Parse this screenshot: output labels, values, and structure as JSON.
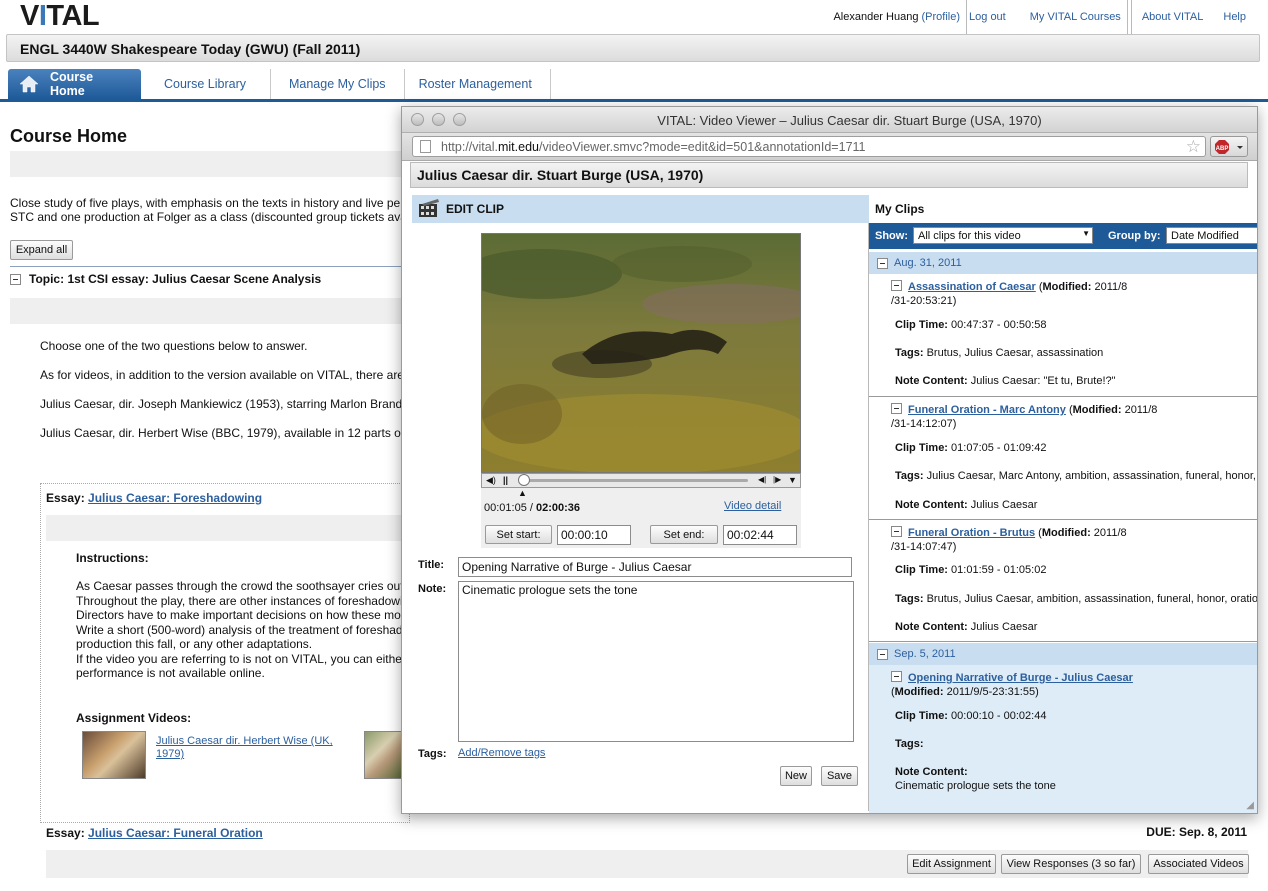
{
  "app": {
    "logo": "VITAL",
    "user": "Alexander Huang",
    "profile": "(Profile)",
    "logout": "Log out",
    "my_courses": "My VITAL Courses",
    "about": "About VITAL",
    "help": "Help",
    "course_title": "ENGL 3440W Shakespeare Today (GWU) (Fall 2011)"
  },
  "tabs": [
    "Course Home",
    "Course Library",
    "Manage My Clips",
    "Roster Management"
  ],
  "page": {
    "title": "Course Home",
    "description_line1": "Close study of five plays, with emphasis on the texts in history and live per",
    "description_line2": "STC and one production at Folger as a class (discounted group tickets ava",
    "expand_all": "Expand all",
    "topic": "Topic: 1st CSI essay: Julius Caesar Scene Analysis",
    "paras": [
      "Choose one of the two questions below to answer.",
      "As for videos, in addition to the version available on VITAL, there are",
      "Julius Caesar, dir. Joseph Mankiewicz (1953), starring Marlon Brand",
      "Julius Caesar, dir. Herbert Wise (BBC, 1979), available in 12 parts o"
    ],
    "essay1_prefix": "Essay: ",
    "essay1_link": "Julius Caesar: Foreshadowing",
    "instructions_label": "Instructions:",
    "instructions": [
      "As Caesar passes through the crowd the soothsayer cries out",
      "Throughout the play, there are other instances of foreshadowi",
      "Directors have to make important decisions on how these mo",
      "Write a short (500-word) analysis of the treatment of foreshad",
      "production this fall, or any other adaptations.",
      "If the video you are referring to is not on VITAL, you can eithe",
      "performance is not available online."
    ],
    "assignment_videos_label": "Assignment Videos:",
    "assignment_video_link_1": "Julius Caesar dir. Herbert Wise (UK,",
    "assignment_video_link_2": "1979)",
    "essay2_prefix": "Essay: ",
    "essay2_link": "Julius Caesar: Funeral Oration",
    "essay2_due": "DUE: Sep. 8, 2011",
    "buttons": [
      "Edit Assignment",
      "View Responses (3 so far)",
      "Associated Videos"
    ]
  },
  "popup": {
    "window_title": "VITAL: Video Viewer – Julius Caesar dir. Stuart Burge (USA, 1970)",
    "url_prefix": "http://vital.",
    "url_domain": "mit.edu",
    "url_rest": "/videoViewer.smvc?mode=edit&id=501&annotationId=1711",
    "video_title": "Julius Caesar dir. Stuart Burge (USA, 1970)",
    "edit_clip_label": "EDIT CLIP",
    "current_time": "00:01:05 / ",
    "total_time": "02:00:36",
    "video_detail": "Video detail",
    "set_start_label": "Set start:",
    "start_value": "00:00:10",
    "set_end_label": "Set end:",
    "end_value": "00:02:44",
    "title_label": "Title:",
    "title_value": "Opening Narrative of Burge - Julius Caesar",
    "note_label": "Note:",
    "note_value": "Cinematic prologue sets the tone",
    "tags_label": "Tags:",
    "tags_link": "Add/Remove tags",
    "new_button": "New",
    "save_button": "Save"
  },
  "clips": {
    "heading": "My Clips",
    "show_label": "Show:",
    "show_value": "All clips for this video",
    "group_label": "Group by:",
    "group_value": "Date Modified",
    "groups": [
      {
        "date": "Aug. 31, 2011",
        "items": [
          {
            "title": "Assassination of Caesar",
            "modified_label": "Modified:",
            "modified_a": " 2011/8",
            "modified_b": "/31-20:53:21)",
            "time_label": "Clip Time:",
            "time": " 00:47:37 - 00:50:58",
            "tags_label": "Tags:",
            "tags": " Brutus, Julius Caesar, assassination",
            "note_label": "Note Content:",
            "note": " Julius Caesar: \"Et tu, Brute!?\""
          },
          {
            "title": "Funeral Oration - Marc Antony",
            "modified_label": "Modified:",
            "modified_a": " 2011/8",
            "modified_b": "/31-14:12:07)",
            "time_label": "Clip Time:",
            "time": " 01:07:05 - 01:09:42",
            "tags_label": "Tags:",
            "tags": " Julius Caesar, Marc Antony, ambition, assassination, funeral, honor,",
            "note_label": "Note Content:",
            "note": " Julius Caesar"
          },
          {
            "title": "Funeral Oration - Brutus",
            "modified_label": "Modified:",
            "modified_a": " 2011/8",
            "modified_b": "/31-14:07:47)",
            "time_label": "Clip Time:",
            "time": " 01:01:59 - 01:05:02",
            "tags_label": "Tags:",
            "tags": " Brutus, Julius Caesar, ambition, assassination, funeral, honor, oratio",
            "note_label": "Note Content:",
            "note": " Julius Caesar"
          }
        ]
      },
      {
        "date": "Sep. 5, 2011",
        "items": [
          {
            "title": "Opening Narrative of Burge - Julius Caesar",
            "modified_label": "Modified:",
            "modified_b": " 2011/9/5-23:31:55)",
            "time_label": "Clip Time:",
            "time": " 00:00:10 - 00:02:44",
            "tags_label": "Tags:",
            "note_label": "Note Content:",
            "note": "Cinematic prologue sets the tone"
          }
        ]
      }
    ]
  },
  "colors": {
    "accent": "#1f5a98",
    "link": "#2c5f9e",
    "header_blue": "#c8ddef"
  }
}
